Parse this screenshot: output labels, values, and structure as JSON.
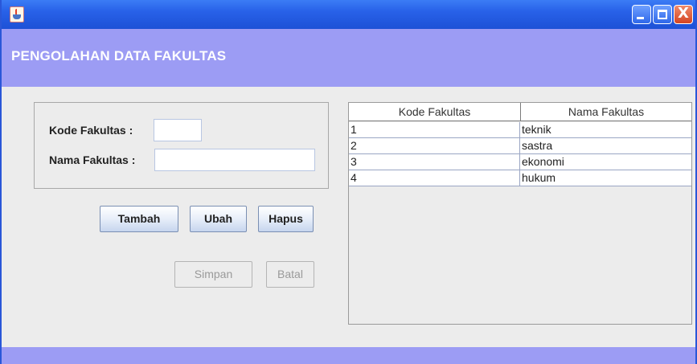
{
  "window": {
    "header_title": "PENGOLAHAN DATA FAKULTAS",
    "icons": {
      "app": "java-icon",
      "minimize": "minimize-icon",
      "maximize": "maximize-icon",
      "close": "close-icon"
    },
    "close_glyph": "X"
  },
  "form": {
    "kode_label": "Kode Fakultas :",
    "kode_value": "",
    "nama_label": "Nama Fakultas :",
    "nama_value": ""
  },
  "buttons": {
    "tambah": "Tambah",
    "ubah": "Ubah",
    "hapus": "Hapus",
    "simpan": "Simpan",
    "batal": "Batal"
  },
  "table": {
    "columns": [
      "Kode Fakultas",
      "Nama Fakultas"
    ],
    "rows": [
      [
        "1",
        "teknik"
      ],
      [
        "2",
        "sastra"
      ],
      [
        "3",
        "ekonomi"
      ],
      [
        "4",
        "hukum"
      ]
    ]
  },
  "colors": {
    "titlebar": "#2861e8",
    "header_band": "#9c9cf4",
    "panel_bg": "#ececec"
  }
}
